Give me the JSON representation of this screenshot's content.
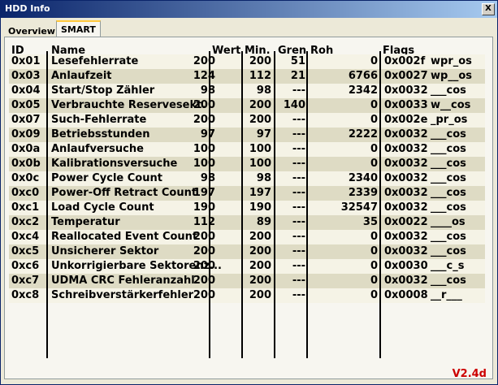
{
  "window": {
    "title": "HDD Info",
    "close_glyph": "X"
  },
  "tabs": [
    {
      "label": "Overview",
      "active": false
    },
    {
      "label": "SMART",
      "active": true
    }
  ],
  "columns": {
    "id": "ID",
    "name": "Name",
    "wert": "Wert",
    "min": "Min.",
    "gren": "Gren",
    "roh": "Roh",
    "flags": "Flags"
  },
  "rows": [
    {
      "id": "0x01",
      "name": "Lesefehlerrate",
      "wert": "200",
      "min": "200",
      "gren": "51",
      "roh": "0",
      "flag": "0x002f",
      "flagstr": "wpr_os"
    },
    {
      "id": "0x03",
      "name": "Anlaufzeit",
      "wert": "124",
      "min": "112",
      "gren": "21",
      "roh": "6766",
      "flag": "0x0027",
      "flagstr": "wp__os"
    },
    {
      "id": "0x04",
      "name": "Start/Stop Zähler",
      "wert": "98",
      "min": "98",
      "gren": "---",
      "roh": "2342",
      "flag": "0x0032",
      "flagstr": "___cos"
    },
    {
      "id": "0x05",
      "name": "Verbrauchte Reservesekt.",
      "wert": "200",
      "min": "200",
      "gren": "140",
      "roh": "0",
      "flag": "0x0033",
      "flagstr": "w__cos"
    },
    {
      "id": "0x07",
      "name": "Such-Fehlerrate",
      "wert": "200",
      "min": "200",
      "gren": "---",
      "roh": "0",
      "flag": "0x002e",
      "flagstr": "_pr_os"
    },
    {
      "id": "0x09",
      "name": "Betriebsstunden",
      "wert": "97",
      "min": "97",
      "gren": "---",
      "roh": "2222",
      "flag": "0x0032",
      "flagstr": "___cos"
    },
    {
      "id": "0x0a",
      "name": "Anlaufversuche",
      "wert": "100",
      "min": "100",
      "gren": "---",
      "roh": "0",
      "flag": "0x0032",
      "flagstr": "___cos"
    },
    {
      "id": "0x0b",
      "name": "Kalibrationsversuche",
      "wert": "100",
      "min": "100",
      "gren": "---",
      "roh": "0",
      "flag": "0x0032",
      "flagstr": "___cos"
    },
    {
      "id": "0x0c",
      "name": "Power Cycle Count",
      "wert": "98",
      "min": "98",
      "gren": "---",
      "roh": "2340",
      "flag": "0x0032",
      "flagstr": "___cos"
    },
    {
      "id": "0xc0",
      "name": "Power-Off Retract Count",
      "wert": "197",
      "min": "197",
      "gren": "---",
      "roh": "2339",
      "flag": "0x0032",
      "flagstr": "___cos"
    },
    {
      "id": "0xc1",
      "name": "Load Cycle Count",
      "wert": "190",
      "min": "190",
      "gren": "---",
      "roh": "32547",
      "flag": "0x0032",
      "flagstr": "___cos"
    },
    {
      "id": "0xc2",
      "name": "Temperatur",
      "wert": "112",
      "min": "89",
      "gren": "---",
      "roh": "35",
      "flag": "0x0022",
      "flagstr": "____os"
    },
    {
      "id": "0xc4",
      "name": "Reallocated Event Count",
      "wert": "200",
      "min": "200",
      "gren": "---",
      "roh": "0",
      "flag": "0x0032",
      "flagstr": "___cos"
    },
    {
      "id": "0xc5",
      "name": "Unsicherer Sektor",
      "wert": "200",
      "min": "200",
      "gren": "---",
      "roh": "0",
      "flag": "0x0032",
      "flagstr": "___cos"
    },
    {
      "id": "0xc6",
      "name": "Unkorrigierbare Sektorenz...",
      "wert": "200",
      "min": "200",
      "gren": "---",
      "roh": "0",
      "flag": "0x0030",
      "flagstr": "___c_s"
    },
    {
      "id": "0xc7",
      "name": "UDMA CRC Fehleranzahl",
      "wert": "200",
      "min": "200",
      "gren": "---",
      "roh": "0",
      "flag": "0x0032",
      "flagstr": "___cos"
    },
    {
      "id": "0xc8",
      "name": "Schreibverstärkerfehler",
      "wert": "200",
      "min": "200",
      "gren": "---",
      "roh": "0",
      "flag": "0x0008",
      "flagstr": "__r___"
    }
  ],
  "footer": {
    "version": "V2.4d",
    "version_color": "#cc0000"
  },
  "colors": {
    "title_bar": "#0a246a",
    "row_alt": "#dedbc4",
    "row_base": "#f5f3e6"
  }
}
